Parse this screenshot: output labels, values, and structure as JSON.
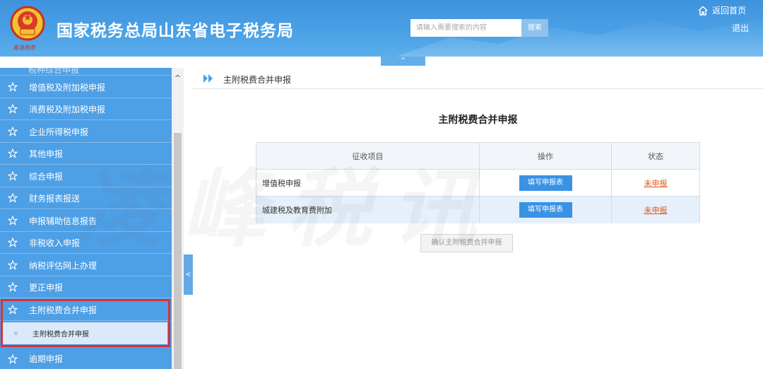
{
  "header": {
    "emblem_text": "青岛税务",
    "title": "国家税务总局山东省电子税务局",
    "search": {
      "placeholder": "请输入需要搜索的内容",
      "button": "搜索"
    },
    "home_label": "返回首页",
    "logout_label": "退出",
    "collapse_glyph": "^"
  },
  "sidebar": {
    "partial_item": "税种综合申报",
    "items": [
      {
        "label": "增值税及附加税申报"
      },
      {
        "label": "消费税及附加税申报"
      },
      {
        "label": "企业所得税申报"
      },
      {
        "label": "其他申报"
      },
      {
        "label": "综合申报"
      },
      {
        "label": "财务报表报送"
      },
      {
        "label": "申报辅助信息报告"
      },
      {
        "label": "非税收入申报"
      },
      {
        "label": "纳税评估网上办理"
      },
      {
        "label": "更正申报"
      },
      {
        "label": "主附税费合并申报",
        "active": true
      }
    ],
    "sub_item": "主附税费合并申报",
    "last_item": "逾期申报",
    "scroll_up": "^",
    "toggle_glyph": "<"
  },
  "main": {
    "breadcrumb": "主附税费合并申报",
    "title": "主附税费合并申报",
    "table": {
      "headers": [
        "征收项目",
        "操作",
        "状态"
      ],
      "rows": [
        {
          "item": "增值税申报",
          "action": "填写申报表",
          "status": "未申报"
        },
        {
          "item": "城建税及教育费附加",
          "action": "填写申报表",
          "status": "未申报"
        }
      ]
    },
    "confirm_button": "确认主附税费合并申报"
  },
  "watermark": "凌峰税讯",
  "colors": {
    "header": "#4a9fe4",
    "sidebar": "#4d9fe6",
    "highlight": "#d9303a",
    "button": "#3a92e4",
    "status": "#e0571c"
  }
}
